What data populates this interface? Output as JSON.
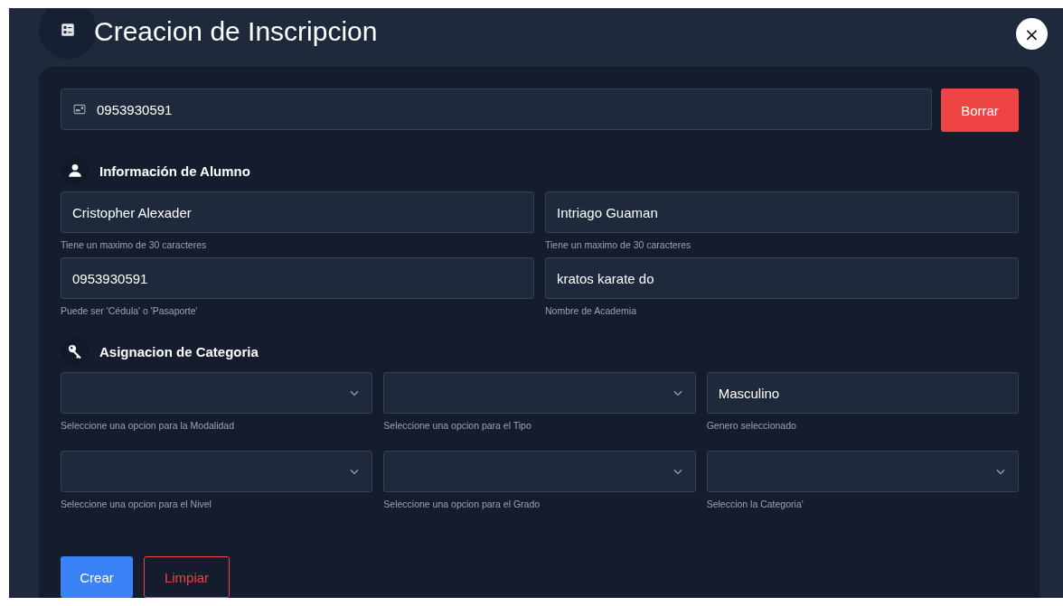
{
  "dialog": {
    "title": "Creacion de Inscripcion",
    "close": "×"
  },
  "search": {
    "value": "0953930591",
    "button": "Borrar"
  },
  "sections": [
    {
      "kind": "student",
      "title": "Información de Alumno",
      "fields": [
        {
          "kind": "input",
          "value": "Cristopher Alexader",
          "hint": "Tiene un maximo de 30 caracteres"
        },
        {
          "kind": "input",
          "value": "Intriago Guaman",
          "hint": "Tiene un maximo de 30 caracteres"
        },
        {
          "kind": "input",
          "value": "0953930591",
          "hint": "Puede ser 'Cédula' o 'Pasaporte'"
        },
        {
          "kind": "input",
          "value": "kratos karate do",
          "hint": "Nombre de Academia"
        }
      ]
    },
    {
      "kind": "category",
      "title": "Asignacion de Categoria",
      "fields": [
        {
          "kind": "select",
          "hint": "Seleccione una opcion para la Modalidad"
        },
        {
          "kind": "select",
          "hint": "Seleccione una opcion para el Tipo"
        },
        {
          "kind": "input",
          "value": "Masculino",
          "hint": "Genero seleccionado"
        },
        {
          "kind": "select",
          "hint": "Seleccione una opcion para el Nivel"
        },
        {
          "kind": "select",
          "hint": "Seleccione una opcion para el Grado"
        },
        {
          "kind": "select",
          "hint": "Seleccion la Categoria'"
        }
      ]
    }
  ],
  "actions": [
    {
      "kind": "primary",
      "label": "Crear"
    },
    {
      "kind": "outline",
      "label": "Limpiar"
    }
  ]
}
